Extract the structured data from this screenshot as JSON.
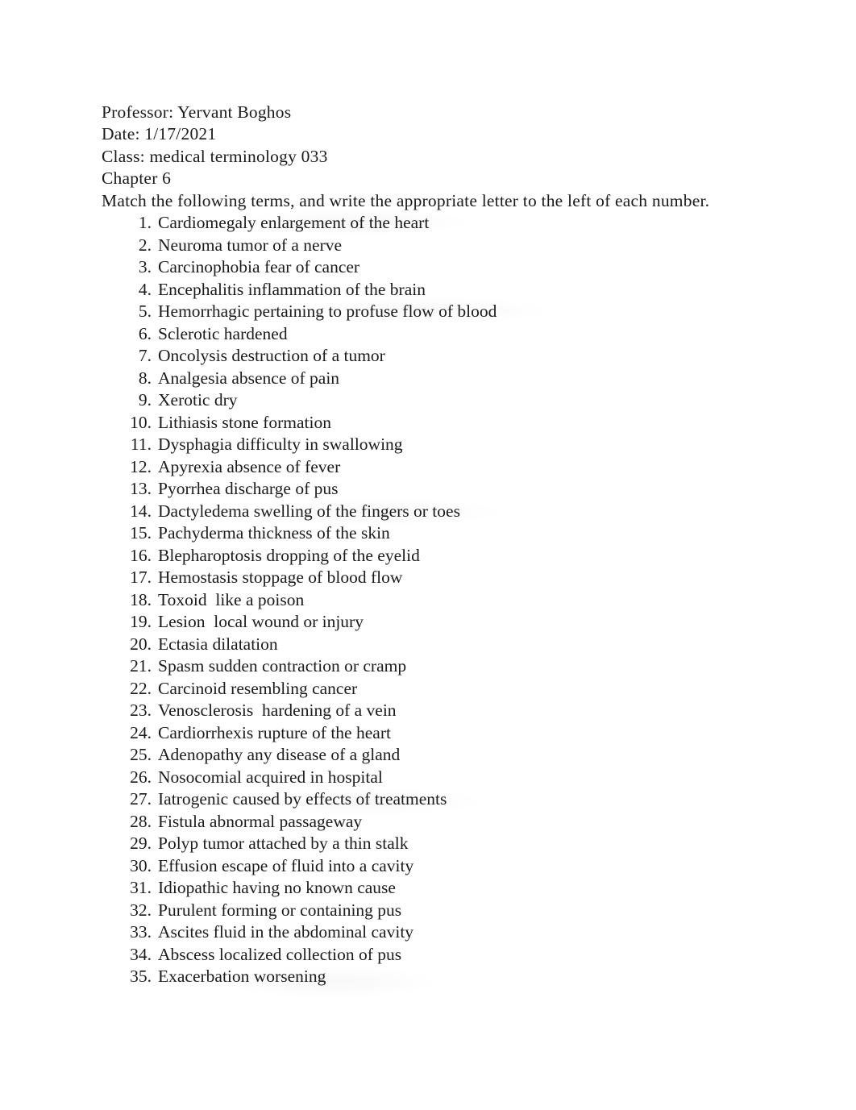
{
  "document": {
    "page_background": "#ffffff",
    "text_color": "#1b1b1b",
    "header_lines": [
      "Professor: Yervant Boghos",
      "Date: 1/17/2021",
      "Class: medical terminology 033",
      "Chapter 6"
    ],
    "instruction": "Match the following terms, and write the appropriate letter to the left of each number.",
    "list": {
      "type": "ordered-decimal",
      "count": 35,
      "items": [
        {
          "number": "1.",
          "text": "Cardiomegaly enlargement of the heart"
        },
        {
          "number": "2.",
          "text": "Neuroma tumor of a nerve"
        },
        {
          "number": "3.",
          "text": "Carcinophobia fear of cancer"
        },
        {
          "number": "4.",
          "text": "Encephalitis inflammation of the brain"
        },
        {
          "number": "5.",
          "text": "Hemorrhagic pertaining to profuse flow of blood"
        },
        {
          "number": "6.",
          "text": "Sclerotic hardened"
        },
        {
          "number": "7.",
          "text": "Oncolysis destruction of a tumor"
        },
        {
          "number": "8.",
          "text": "Analgesia absence of pain"
        },
        {
          "number": "9.",
          "text": "Xerotic dry"
        },
        {
          "number": "10.",
          "text": "Lithiasis stone formation"
        },
        {
          "number": "11.",
          "text": "Dysphagia difficulty in swallowing"
        },
        {
          "number": "12.",
          "text": "Apyrexia absence of fever"
        },
        {
          "number": "13.",
          "text": "Pyorrhea discharge of pus"
        },
        {
          "number": "14.",
          "text": "Dactyledema swelling of the fingers or toes"
        },
        {
          "number": "15.",
          "text": "Pachyderma thickness of the skin"
        },
        {
          "number": "16.",
          "text": "Blepharoptosis dropping of the eyelid"
        },
        {
          "number": "17.",
          "text": "Hemostasis stoppage of blood flow"
        },
        {
          "number": "18.",
          "text": "Toxoid  like a poison"
        },
        {
          "number": "19.",
          "text": "Lesion  local wound or injury"
        },
        {
          "number": "20.",
          "text": "Ectasia dilatation"
        },
        {
          "number": "21.",
          "text": "Spasm sudden contraction or cramp"
        },
        {
          "number": "22.",
          "text": "Carcinoid resembling cancer"
        },
        {
          "number": "23.",
          "text": "Venosclerosis  hardening of a vein"
        },
        {
          "number": "24.",
          "text": "Cardiorrhexis rupture of the heart"
        },
        {
          "number": "25.",
          "text": "Adenopathy any disease of a gland"
        },
        {
          "number": "26.",
          "text": "Nosocomial acquired in hospital"
        },
        {
          "number": "27.",
          "text": "Iatrogenic caused by effects of treatments"
        },
        {
          "number": "28.",
          "text": "Fistula abnormal passageway"
        },
        {
          "number": "29.",
          "text": "Polyp tumor attached by a thin stalk"
        },
        {
          "number": "30.",
          "text": "Effusion escape of fluid into a cavity"
        },
        {
          "number": "31.",
          "text": "Idiopathic having no known cause"
        },
        {
          "number": "32.",
          "text": "Purulent forming or containing pus"
        },
        {
          "number": "33.",
          "text": "Ascites fluid in the abdominal cavity"
        },
        {
          "number": "34.",
          "text": "Abscess localized collection of pus"
        },
        {
          "number": "35.",
          "text": "Exacerbation worsening"
        }
      ]
    }
  }
}
